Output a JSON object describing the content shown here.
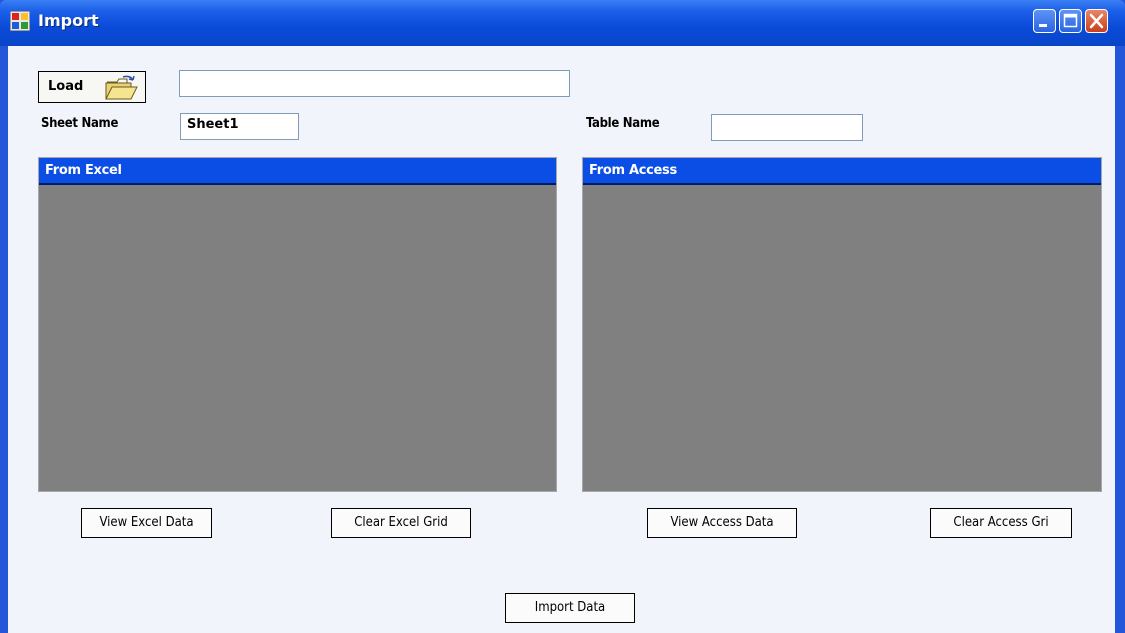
{
  "window": {
    "title": "Import"
  },
  "load": {
    "label": "Load",
    "path_value": ""
  },
  "sheet": {
    "label": "Sheet Name",
    "value": "Sheet1"
  },
  "table": {
    "label": "Table Name",
    "value": ""
  },
  "excel_panel": {
    "header": "From Excel"
  },
  "access_panel": {
    "header": "From Access"
  },
  "buttons": {
    "view_excel": "View Excel Data",
    "clear_excel": "Clear Excel Grid",
    "view_access": "View Access Data",
    "clear_access": "Clear Access Gri",
    "import": "Import Data"
  },
  "icons": {
    "app": "app-icon",
    "load": "open-folder-icon",
    "minimize": "minimize-icon",
    "maximize": "maximize-icon",
    "close": "close-icon"
  },
  "colors": {
    "title_bar": "#0a4bd8",
    "panel_header": "#0b4ee6",
    "grid_bg": "#808080",
    "client_bg": "#f1f5fb"
  }
}
